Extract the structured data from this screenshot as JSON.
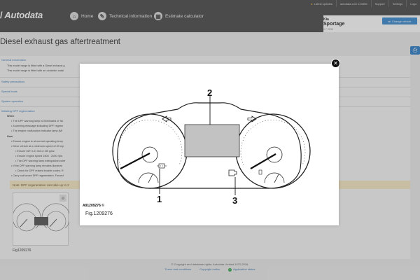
{
  "header": {
    "logo": "Autodata",
    "nav": [
      {
        "icon": "home-icon",
        "label": "Home"
      },
      {
        "icon": "wrench-icon",
        "label": "Technical information"
      },
      {
        "icon": "calculator-icon",
        "label": "Estimate calculator"
      }
    ],
    "toplinks": [
      "Latest updates",
      "autodata.com 123456",
      "Support",
      "Settings",
      "Logo"
    ],
    "vehicle": {
      "make": "Kia",
      "model": "Sportage",
      "engine": "1.7 CRDi",
      "change_label": "Change vehicle"
    }
  },
  "page": {
    "title": "Diesel exhaust gas aftertreatment",
    "sections": {
      "general": "General information",
      "general_lines": [
        "This model range is fitted with a Diesel exhaust g",
        "This model range is fitted with an oxidation catal"
      ],
      "safety": "Safety precautions",
      "tools": "Special tools",
      "system": "System operation",
      "regen": "Initiating DPF regeneration",
      "when_label": "When",
      "when_lines": [
        "The DPF warning lamp is illuminated or fla",
        "A warning message indicating DPF regene",
        "The engine malfunction indicator lamp (MI"
      ],
      "how_label": "How",
      "how_lines": [
        "Ensure engine is at normal operating temp",
        "Drive vehicle at a minimum speed of 40 mp",
        "Ensure M/T is in 3rd or 4th gear.",
        "Ensure engine speed 1500 - 2000 rpm.",
        "The DPF warning lamp extinguishes whe",
        "If the DPF warning lamp remains illuminat",
        "Check for DPF related trouble codes. R",
        "Carry out forced DPF regeneration. Forced"
      ]
    },
    "note": "Note: DPF regeneration can take up to 2",
    "thumb_caption": "Fig1209276",
    "print_icon": "print-icon"
  },
  "modal": {
    "caption": "Fig.1209276",
    "figure_code": "A91209276 ©",
    "callouts": [
      "1",
      "2",
      "3"
    ]
  },
  "footer": {
    "copyright": "© Copyright and database rights: Autodata Limited 1972-2016.",
    "links": [
      "Terms and conditions",
      "Copyright notice",
      "Application status"
    ]
  }
}
